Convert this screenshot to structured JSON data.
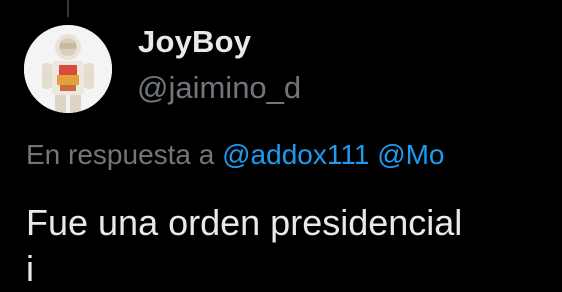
{
  "author": {
    "display_name": "JoyBoy",
    "handle": "@jaimino_d",
    "avatar_icon": "anatomy-toy-figure-icon"
  },
  "reply": {
    "prefix": "En respuesta a",
    "mentions": [
      "@addox111",
      "@Mo"
    ]
  },
  "tweet": {
    "lines": [
      "Fue una orden presidencial",
      "i                              "
    ]
  },
  "colors": {
    "background": "#000000",
    "primary_text": "#e7e9ea",
    "secondary_text": "#71767b",
    "link": "#1d9bf0"
  }
}
